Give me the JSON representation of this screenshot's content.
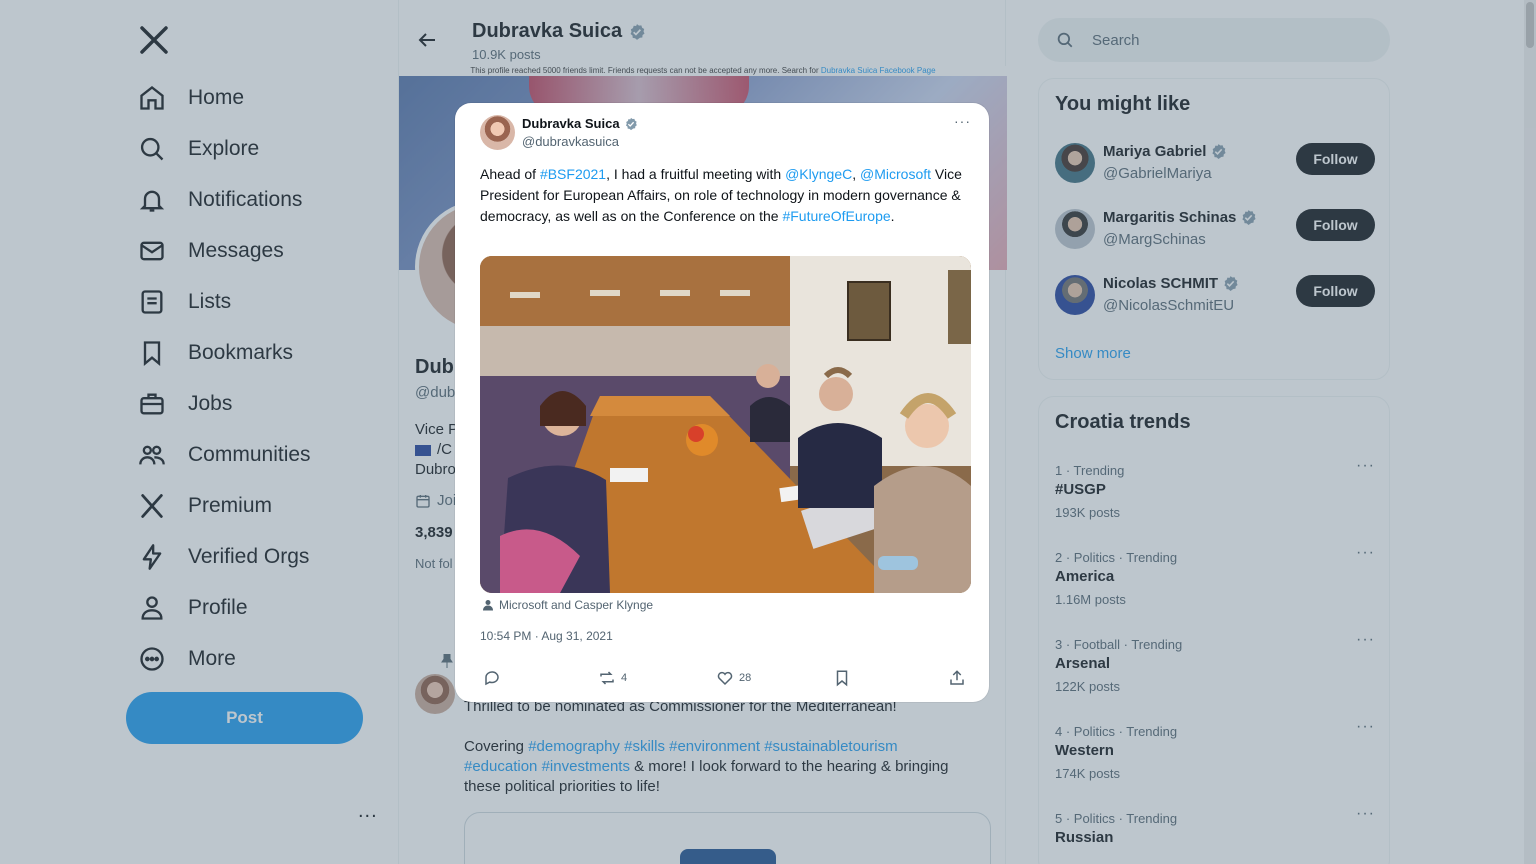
{
  "nav": {
    "items": [
      {
        "label": "Home",
        "icon": "home-icon"
      },
      {
        "label": "Explore",
        "icon": "search-icon"
      },
      {
        "label": "Notifications",
        "icon": "bell-icon"
      },
      {
        "label": "Messages",
        "icon": "envelope-icon"
      },
      {
        "label": "Lists",
        "icon": "list-icon"
      },
      {
        "label": "Bookmarks",
        "icon": "bookmark-icon"
      },
      {
        "label": "Jobs",
        "icon": "briefcase-icon"
      },
      {
        "label": "Communities",
        "icon": "people-icon"
      },
      {
        "label": "Premium",
        "icon": "x-logo-icon"
      },
      {
        "label": "Verified Orgs",
        "icon": "lightning-icon"
      },
      {
        "label": "Profile",
        "icon": "person-icon"
      },
      {
        "label": "More",
        "icon": "more-circle-icon"
      }
    ],
    "post_label": "Post",
    "more_dots": "..."
  },
  "profile": {
    "header_name": "Dubravka Suica",
    "post_count": "10.9K posts",
    "banner_notice": "This profile reached 5000 friends limit. Friends requests can not be accepted any more. Search for",
    "banner_link": "Dubravka Suica Facebook Page",
    "name_partial": "Dub",
    "handle_partial": "@dub",
    "bio_line1": "Vice P",
    "bio_line2": "/C",
    "bio_line3": "Dubro",
    "joined_partial": "Joi",
    "stats_partial": "3,839",
    "not_followed": "Not fol"
  },
  "pinned_post": {
    "line1": "Thrilled to be nominated as Commissioner for the Mediterranean!",
    "covering": "Covering",
    "tags_line1": [
      "#demography",
      "#skills",
      "#environment",
      "#sustainabletourism"
    ],
    "tags_line2": [
      "#education",
      "#investments"
    ],
    "rest_line2": "& more! I look forward to the hearing & bringing",
    "line3": "these political priorities to life!"
  },
  "search": {
    "placeholder": "Search"
  },
  "you_might_like": {
    "title": "You might like",
    "accounts": [
      {
        "name": "Mariya Gabriel",
        "handle": "@GabrielMariya",
        "follow": "Follow"
      },
      {
        "name": "Margaritis Schinas",
        "handle": "@MargSchinas",
        "follow": "Follow"
      },
      {
        "name": "Nicolas SCHMIT",
        "handle": "@NicolasSchmitEU",
        "follow": "Follow"
      }
    ],
    "show_more": "Show more"
  },
  "trends": {
    "title": "Croatia trends",
    "items": [
      {
        "meta": "1 · Trending",
        "title": "#USGP",
        "count": "193K posts"
      },
      {
        "meta": "2 · Politics · Trending",
        "title": "America",
        "count": "1.16M posts"
      },
      {
        "meta": "3 · Football · Trending",
        "title": "Arsenal",
        "count": "122K posts"
      },
      {
        "meta": "4 · Politics · Trending",
        "title": "Western",
        "count": "174K posts"
      },
      {
        "meta": "5 · Politics · Trending",
        "title": "Russian",
        "count": ""
      }
    ],
    "dots": "···"
  },
  "modal": {
    "name": "Dubravka Suica",
    "handle": "@dubravkasuica",
    "more": "···",
    "text": {
      "p1": "Ahead of ",
      "h1": "#BSF2021",
      "p2": ", I had a fruitful meeting with ",
      "h2": "@KlyngeC",
      "p3": ", ",
      "h3": "@Microsoft",
      "p4": "Vice President for European Affairs, on role of technology in modern governance & democracy, as well as on the Conference on the ",
      "h4": "#FutureOfEurope",
      "p5": "."
    },
    "tagged": "Microsoft and Casper Klynge",
    "timestamp": "10:54 PM · Aug 31, 2021",
    "retweets": "4",
    "likes": "28"
  },
  "colors": {
    "accent": "#1d9bf0",
    "verified": "#829aab",
    "text": "#0f1419",
    "muted": "#536471",
    "overlay": "rgba(91,112,131,0.4)"
  }
}
